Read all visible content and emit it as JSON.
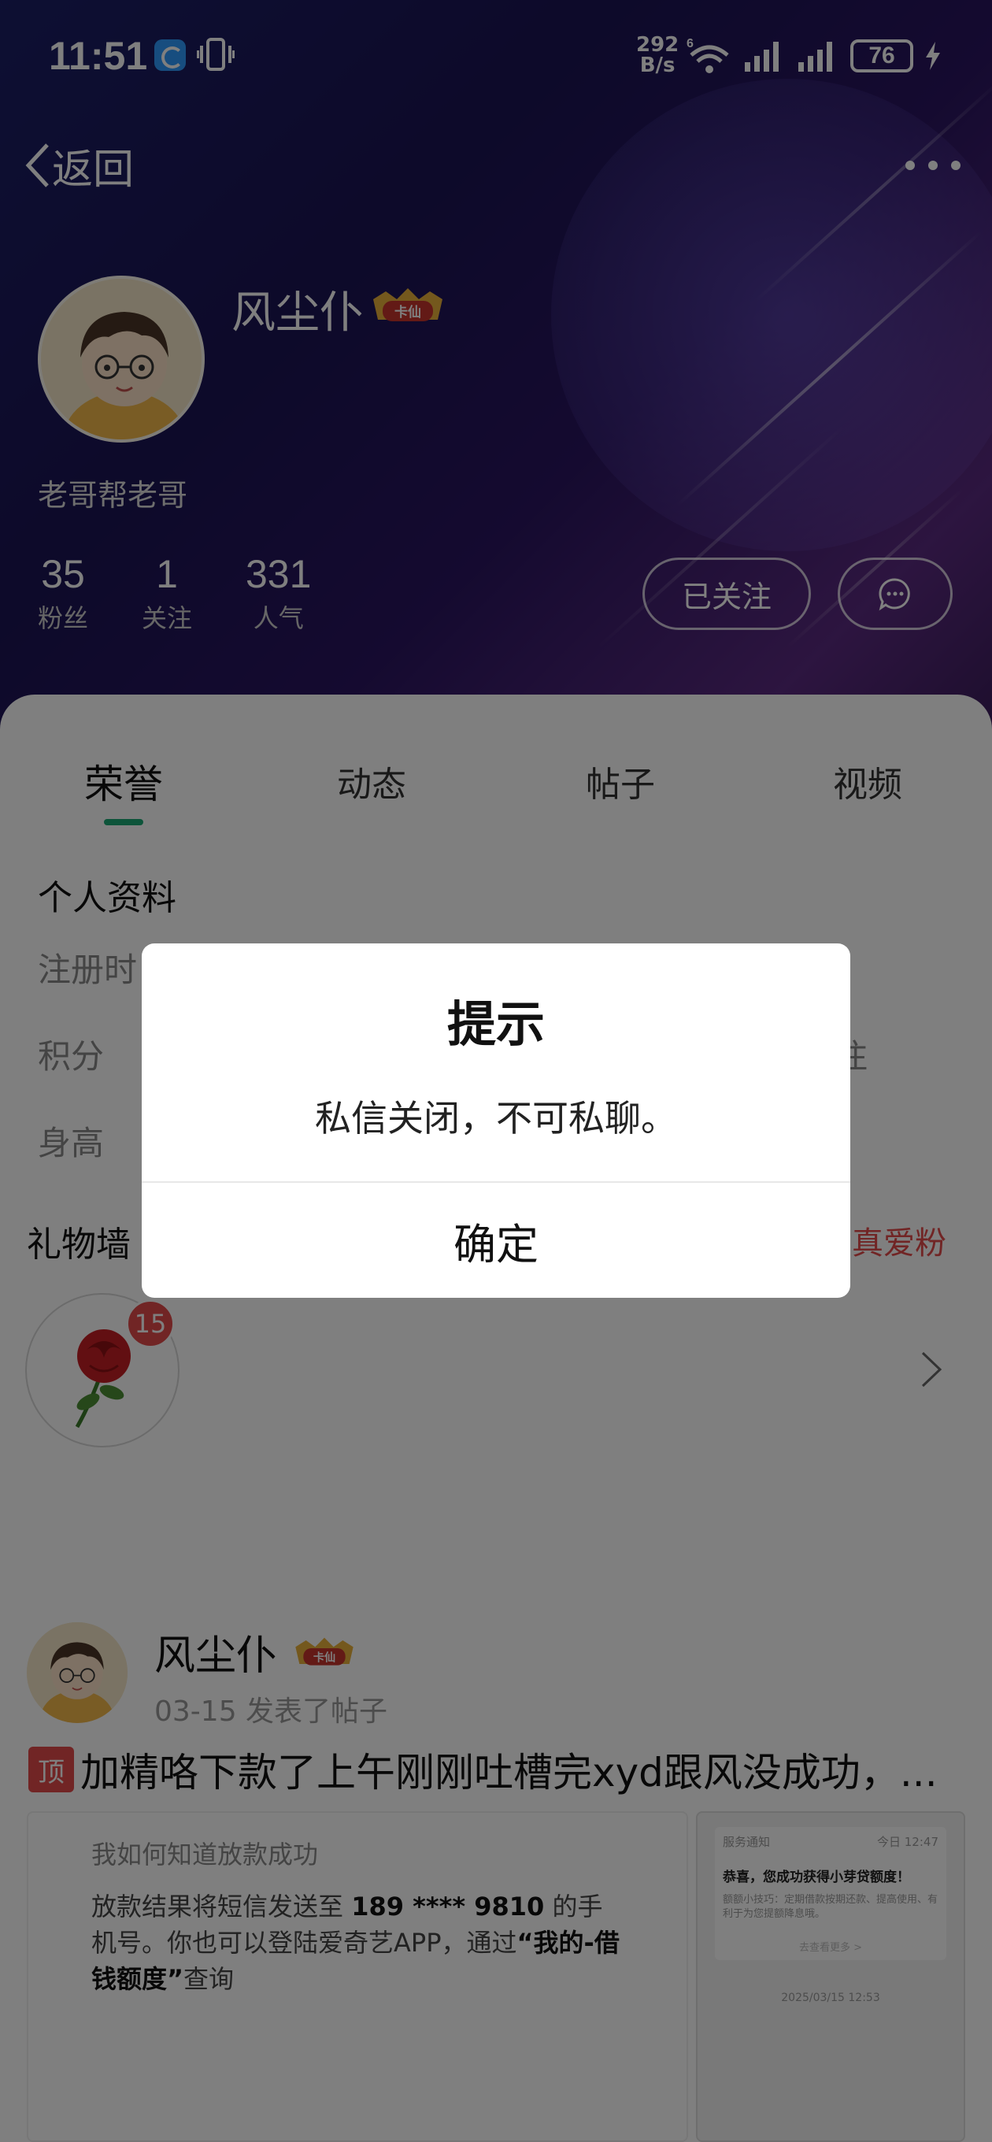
{
  "status_bar": {
    "time": "11:51",
    "net_speed_value": "292",
    "net_speed_unit": "B/s",
    "network_type": "6",
    "battery": "76"
  },
  "nav": {
    "back_label": "返回"
  },
  "profile": {
    "username": "风尘仆",
    "badge_text": "卡仙",
    "bio": "老哥帮老哥",
    "stats": [
      {
        "value": "35",
        "label": "粉丝"
      },
      {
        "value": "1",
        "label": "关注"
      },
      {
        "value": "331",
        "label": "人气"
      }
    ],
    "follow_label": "已关注"
  },
  "tabs": [
    {
      "label": "荣誉",
      "active": true
    },
    {
      "label": "动态",
      "active": false
    },
    {
      "label": "帖子",
      "active": false
    },
    {
      "label": "视频",
      "active": false
    }
  ],
  "honor": {
    "section_title": "个人资料",
    "rows": [
      "注册时",
      "积分",
      "身高"
    ],
    "row_right_partial": "注",
    "gift_wall_title": "礼物墙",
    "gift_rank_partial": "的真爱粉",
    "gift_count": "15"
  },
  "post": {
    "author": "风尘仆",
    "badge_text": "卡仙",
    "meta": "03-15 发表了帖子",
    "top_tag": "顶",
    "title": "加精咯下款了上午刚刚吐槽完xyd跟风没成功，...",
    "image1": {
      "line1": "我如何知道放款成功",
      "line2_pre": "放款结果将短信发送至",
      "phone": "189 **** 9810",
      "line2_mid": "的手机号。你也可以登陆爱奇艺APP，通过",
      "bold": "“我的-借钱额度”",
      "line2_post": "查询"
    },
    "image2": {
      "header_left": "服务通知",
      "header_right": "今日 12:47",
      "bold": "恭喜，您成功获得小芽贷额度！",
      "body": "额额小技巧：定期借款按期还款、提高使用、有利于为您提额降息哦。",
      "link": "去查看更多 >",
      "date": "2025/03/15 12:53"
    }
  },
  "dialog": {
    "title": "提示",
    "message": "私信关闭，不可私聊。",
    "confirm_label": "确定"
  },
  "colors": {
    "accent_green": "#1aa874",
    "badge_red": "#e34a4a",
    "header_dark": "#1a1454"
  }
}
